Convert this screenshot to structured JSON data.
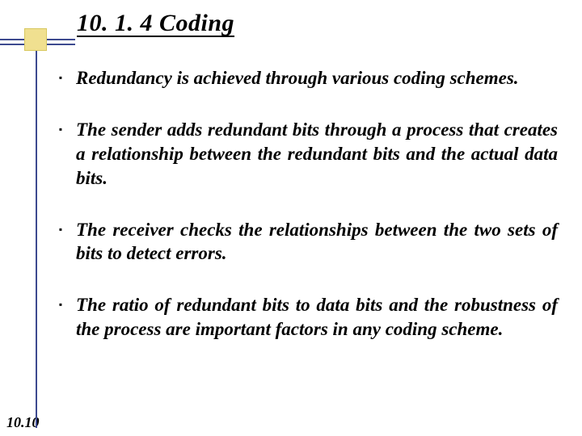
{
  "title": "10. 1. 4  Coding",
  "bullets": [
    "Redundancy is achieved through various coding schemes.",
    " The sender adds redundant bits through a process that creates a relationship between the redundant bits and the actual data bits.",
    " The receiver checks the relationships between the two sets of bits to detect errors.",
    " The ratio of redundant bits to data bits and the robustness of the process are important factors in any coding scheme."
  ],
  "page_number": "10.10",
  "bullet_glyph": "▪"
}
